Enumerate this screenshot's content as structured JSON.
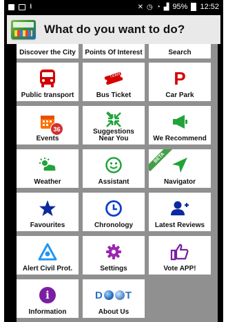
{
  "status_bar": {
    "battery": "95%",
    "time": "12:52"
  },
  "header": {
    "title": "What do you want to do?"
  },
  "tiles": [
    {
      "label": "Discover the City",
      "icon": "city-icon"
    },
    {
      "label": "Points Of Interest",
      "icon": "poi-icon"
    },
    {
      "label": "Search",
      "icon": "search-icon"
    },
    {
      "label": "Public transport",
      "icon": "bus-icon"
    },
    {
      "label": "Bus Ticket",
      "icon": "ticket-icon",
      "ticket_text": "Ticket"
    },
    {
      "label": "Car Park",
      "icon": "parking-icon",
      "glyph": "P"
    },
    {
      "label": "Events",
      "icon": "calendar-icon",
      "badge": "36"
    },
    {
      "label": "Suggestions Near You",
      "icon": "arrows-in-icon"
    },
    {
      "label": "We Recommend",
      "icon": "megaphone-icon"
    },
    {
      "label": "Weather",
      "icon": "weather-icon"
    },
    {
      "label": "Assistant",
      "icon": "smiley-icon"
    },
    {
      "label": "Navigator",
      "icon": "navigator-icon",
      "ribbon": "BETA"
    },
    {
      "label": "Favourites",
      "icon": "star-icon"
    },
    {
      "label": "Chronology",
      "icon": "clock-icon"
    },
    {
      "label": "Latest Reviews",
      "icon": "add-user-icon"
    },
    {
      "label": "Alert Civil Prot.",
      "icon": "alert-icon"
    },
    {
      "label": "Settings",
      "icon": "gear-icon"
    },
    {
      "label": "Vote APP!",
      "icon": "thumbs-up-icon"
    },
    {
      "label": "Information",
      "icon": "info-icon",
      "glyph": "i"
    },
    {
      "label": "About Us",
      "icon": "dsot-logo-icon",
      "logo_text": "D",
      "logo_text2": "T"
    }
  ],
  "colors": {
    "red": "#d50000",
    "blue": "#0d3fd1",
    "green": "#21a33a",
    "orange": "#ff6f00",
    "lightblue": "#2196f3",
    "purple": "#7b1fa2",
    "navy": "#0b2a9e"
  }
}
